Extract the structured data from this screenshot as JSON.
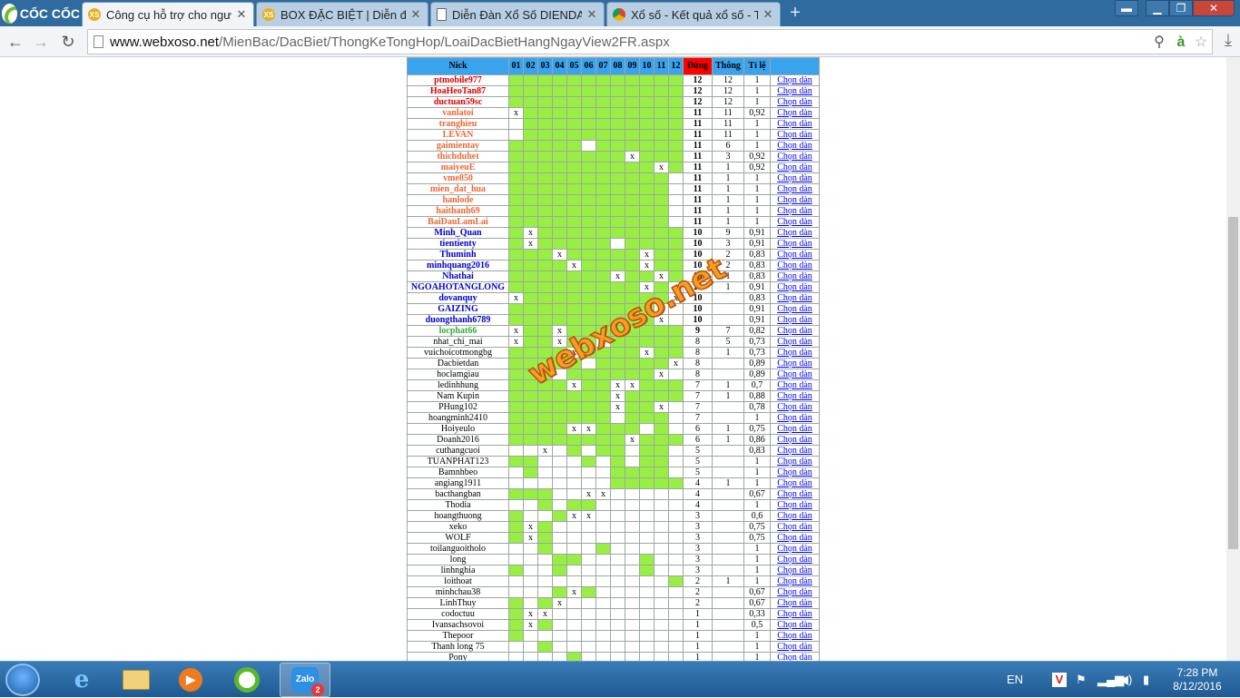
{
  "browser": {
    "logo_text": "CỐC CỐC",
    "tabs": [
      {
        "label": "Công cụ hỗ trợ cho người",
        "icon": "xoso-icon",
        "active": true
      },
      {
        "label": "BOX ĐẶC BIỆT | Diễn đàn",
        "icon": "xoso-icon",
        "active": false
      },
      {
        "label": "Diễn Đàn Xổ Số DIENDAN",
        "icon": "page-icon",
        "active": false
      },
      {
        "label": "Xổ số - Kết quả xổ số - Trự",
        "icon": "chrome-icon",
        "active": false
      }
    ],
    "url_host": "www.webxoso.net",
    "url_path": "/MienBac/DacBiet/ThongKeTongHop/LoaiDacBietHangNgayView2FR.aspx"
  },
  "table": {
    "headers": {
      "nick": "Nick",
      "days": [
        "01",
        "02",
        "03",
        "04",
        "05",
        "06",
        "07",
        "08",
        "09",
        "10",
        "11",
        "12"
      ],
      "dung": "Đúng",
      "thong": "Thông",
      "tile": "Tỉ lệ",
      "action": ""
    },
    "link_label": "Chọn dàn",
    "rows": [
      {
        "nick": "ptmobile977",
        "color": "red",
        "bold": true,
        "cells": "gggggggggggg",
        "dung": "12",
        "thong": "12",
        "tile": "1"
      },
      {
        "nick": "HoaHeoTan87",
        "color": "red",
        "bold": true,
        "cells": "gggggggggggg",
        "dung": "12",
        "thong": "12",
        "tile": "1"
      },
      {
        "nick": "ductuan59sc",
        "color": "red",
        "bold": true,
        "cells": "gggggggggggg",
        "dung": "12",
        "thong": "12",
        "tile": "1"
      },
      {
        "nick": "vanlatoi",
        "color": "org",
        "bold": true,
        "cells": "xggggggggggg",
        "dung": "11",
        "thong": "11",
        "tile": "0,92"
      },
      {
        "nick": "tranghieu",
        "color": "org",
        "bold": true,
        "cells": "-ggggggggggg",
        "dung": "11",
        "thong": "11",
        "tile": "1"
      },
      {
        "nick": "LEVAN",
        "color": "org",
        "bold": true,
        "cells": "-ggggggggggg",
        "dung": "11",
        "thong": "11",
        "tile": "1"
      },
      {
        "nick": "gaimientay",
        "color": "org",
        "bold": true,
        "cells": "ggggg-gggggg",
        "dung": "11",
        "thong": "6",
        "tile": "1"
      },
      {
        "nick": "thichduhet",
        "color": "org",
        "bold": true,
        "cells": "ggggggggxggg",
        "dung": "11",
        "thong": "3",
        "tile": "0,92"
      },
      {
        "nick": "maiyeuE",
        "color": "org",
        "bold": true,
        "cells": "ggggggggggxg",
        "dung": "11",
        "thong": "1",
        "tile": "0,92"
      },
      {
        "nick": "vme850",
        "color": "org",
        "bold": true,
        "cells": "ggggggggggg-",
        "dung": "11",
        "thong": "1",
        "tile": "1"
      },
      {
        "nick": "mien_dat_hua",
        "color": "org",
        "bold": true,
        "cells": "ggggggggggg-",
        "dung": "11",
        "thong": "1",
        "tile": "1"
      },
      {
        "nick": "hanlode",
        "color": "org",
        "bold": true,
        "cells": "ggggggggggg-",
        "dung": "11",
        "thong": "1",
        "tile": "1"
      },
      {
        "nick": "haithanh69",
        "color": "org",
        "bold": true,
        "cells": "ggggggggggg-",
        "dung": "11",
        "thong": "1",
        "tile": "1"
      },
      {
        "nick": "BaiDauLamLai",
        "color": "org",
        "bold": true,
        "cells": "ggggggggggg-",
        "dung": "11",
        "thong": "1",
        "tile": "1"
      },
      {
        "nick": "Minh_Quan",
        "color": "blu",
        "bold": true,
        "cells": "gxgggggggggg",
        "dung": "10",
        "thong": "9",
        "tile": "0,91"
      },
      {
        "nick": "tientienty",
        "color": "blu",
        "bold": true,
        "cells": "gxggggg-gggg",
        "dung": "10",
        "thong": "3",
        "tile": "0,91"
      },
      {
        "nick": "Thuminh",
        "color": "blu",
        "bold": true,
        "cells": "gggxgggggxgg",
        "dung": "10",
        "thong": "2",
        "tile": "0,83"
      },
      {
        "nick": "minhquang2016",
        "color": "blu",
        "bold": true,
        "cells": "ggggxggggxgg",
        "dung": "10",
        "thong": "2",
        "tile": "0,83"
      },
      {
        "nick": "Nhathai",
        "color": "blu",
        "bold": true,
        "cells": "gggggggxggxg",
        "dung": "10",
        "thong": "1",
        "tile": "0,83"
      },
      {
        "nick": "NGOAHOTANGLONG",
        "color": "blu",
        "bold": true,
        "cells": "gggggggggxg-",
        "dung": "10",
        "thong": "1",
        "tile": "0,91"
      },
      {
        "nick": "dovanquy",
        "color": "blu",
        "bold": true,
        "cells": "xggggggggggx",
        "dung": "10",
        "thong": "",
        "tile": "0,83"
      },
      {
        "nick": "GAIZING",
        "color": "blu",
        "bold": true,
        "cells": "ggggggggggx-",
        "dung": "10",
        "thong": "",
        "tile": "0,91"
      },
      {
        "nick": "duongthanh6789",
        "color": "blu",
        "bold": true,
        "cells": "ggggggggggx-",
        "dung": "10",
        "thong": "",
        "tile": "0,91"
      },
      {
        "nick": "locphat66",
        "color": "grn",
        "bold": true,
        "cells": "xggxgggggggg",
        "dung": "9",
        "thong": "7",
        "tile": "0,82"
      },
      {
        "nick": "nhat_chi_mai",
        "color": "blk",
        "bold": false,
        "cells": "xggxggxggggg",
        "dung": "8",
        "thong": "5",
        "tile": "0,73"
      },
      {
        "nick": "vuichoicotmongbg",
        "color": "blk",
        "bold": false,
        "cells": "ggggxggggxgg",
        "dung": "8",
        "thong": "1",
        "tile": "0,73"
      },
      {
        "nick": "Dacbietdan",
        "color": "blk",
        "bold": false,
        "cells": "ggggg-gggggx",
        "dung": "8",
        "thong": "",
        "tile": "0,89"
      },
      {
        "nick": "hoclamgiau",
        "color": "blk",
        "bold": false,
        "cells": "ggg-ggggggx-",
        "dung": "8",
        "thong": "",
        "tile": "0,89"
      },
      {
        "nick": "ledinhhung",
        "color": "blk",
        "bold": false,
        "cells": "ggggxggxxggg",
        "dung": "7",
        "thong": "1",
        "tile": "0,7"
      },
      {
        "nick": "Nam Kupin",
        "color": "blk",
        "bold": false,
        "cells": "gggggggxgggg",
        "dung": "7",
        "thong": "1",
        "tile": "0,88"
      },
      {
        "nick": "PHung102",
        "color": "blk",
        "bold": false,
        "cells": "gggggggxggx-",
        "dung": "7",
        "thong": "",
        "tile": "0,78"
      },
      {
        "nick": "hoangminh2410",
        "color": "blk",
        "bold": false,
        "cells": "ggggggg-ggg-",
        "dung": "7",
        "thong": "",
        "tile": "1"
      },
      {
        "nick": "Hoiyeulo",
        "color": "blk",
        "bold": false,
        "cells": "ggggxxggg-g-",
        "dung": "6",
        "thong": "1",
        "tile": "0,75"
      },
      {
        "nick": "Doanh2016",
        "color": "blk",
        "bold": false,
        "cells": "ggggggggxggg",
        "dung": "6",
        "thong": "1",
        "tile": "0,86"
      },
      {
        "nick": "cuthangcuoi",
        "color": "blk",
        "bold": false,
        "cells": "--x-g-gg-gg-",
        "dung": "5",
        "thong": "",
        "tile": "0,83"
      },
      {
        "nick": "TUANPHAT123",
        "color": "blk",
        "bold": false,
        "cells": "gg---g-g-gg-",
        "dung": "5",
        "thong": "",
        "tile": "1"
      },
      {
        "nick": "Bamnhbeo",
        "color": "blk",
        "bold": false,
        "cells": "-g-----gggg-",
        "dung": "5",
        "thong": "",
        "tile": "1"
      },
      {
        "nick": "angiang1911",
        "color": "blk",
        "bold": false,
        "cells": "-------ggggg",
        "dung": "4",
        "thong": "1",
        "tile": "1"
      },
      {
        "nick": "bacthangban",
        "color": "blk",
        "bold": false,
        "cells": "ggg--xx-----",
        "dung": "4",
        "thong": "",
        "tile": "0,67"
      },
      {
        "nick": "Thodia",
        "color": "blk",
        "bold": false,
        "cells": "--g-gg------",
        "dung": "4",
        "thong": "",
        "tile": "1"
      },
      {
        "nick": "hoangthuong",
        "color": "blk",
        "bold": false,
        "cells": "g--gxx------",
        "dung": "3",
        "thong": "",
        "tile": "0,6"
      },
      {
        "nick": "xeko",
        "color": "blk",
        "bold": false,
        "cells": "gxg---------",
        "dung": "3",
        "thong": "",
        "tile": "0,75"
      },
      {
        "nick": "WOLF",
        "color": "blk",
        "bold": false,
        "cells": "gxg---------",
        "dung": "3",
        "thong": "",
        "tile": "0,75"
      },
      {
        "nick": "toilanguoitholo",
        "color": "blk",
        "bold": false,
        "cells": "--g---g-----",
        "dung": "3",
        "thong": "",
        "tile": "1"
      },
      {
        "nick": "long",
        "color": "blk",
        "bold": false,
        "cells": "---gg----g--",
        "dung": "3",
        "thong": "",
        "tile": "1"
      },
      {
        "nick": "linhnghia",
        "color": "blk",
        "bold": false,
        "cells": "g--g-----g--",
        "dung": "3",
        "thong": "",
        "tile": "1"
      },
      {
        "nick": "loithoat",
        "color": "blk",
        "bold": false,
        "cells": "-----------g",
        "dung": "2",
        "thong": "1",
        "tile": "1"
      },
      {
        "nick": "minhchau38",
        "color": "blk",
        "bold": false,
        "cells": "---gxg------",
        "dung": "2",
        "thong": "",
        "tile": "0,67"
      },
      {
        "nick": "LinhThuy",
        "color": "blk",
        "bold": false,
        "cells": "g-gx--------",
        "dung": "2",
        "thong": "",
        "tile": "0,67"
      },
      {
        "nick": "codoctuu",
        "color": "blk",
        "bold": false,
        "cells": "gxx---------",
        "dung": "1",
        "thong": "",
        "tile": "0,33"
      },
      {
        "nick": "Ivansachsovoi",
        "color": "blk",
        "bold": false,
        "cells": "gxg---------",
        "dung": "1",
        "thong": "",
        "tile": "0,5"
      },
      {
        "nick": "Thepoor",
        "color": "blk",
        "bold": false,
        "cells": "g-----------",
        "dung": "1",
        "thong": "",
        "tile": "1"
      },
      {
        "nick": "Thanh long 75",
        "color": "blk",
        "bold": false,
        "cells": "--g---------",
        "dung": "1",
        "thong": "",
        "tile": "1"
      },
      {
        "nick": "Pony",
        "color": "blk",
        "bold": false,
        "cells": "----g-------",
        "dung": "1",
        "thong": "",
        "tile": "1"
      }
    ]
  },
  "watermark": "webxoso.net",
  "taskbar": {
    "zalo_label": "Zalo",
    "zalo_badge": "2",
    "lang": "EN",
    "time": "7:28 PM",
    "date": "8/12/2016"
  }
}
